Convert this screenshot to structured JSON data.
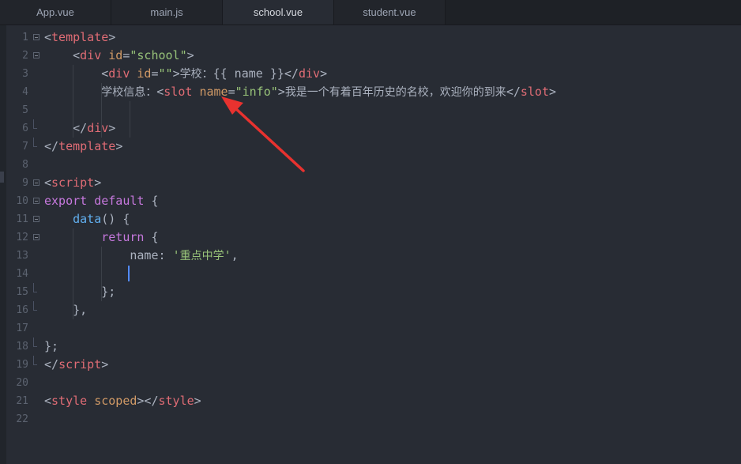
{
  "tabs": [
    {
      "label": "App.vue",
      "active": false
    },
    {
      "label": "main.js",
      "active": false
    },
    {
      "label": "school.vue",
      "active": true
    },
    {
      "label": "student.vue",
      "active": false
    }
  ],
  "gutter": [
    {
      "num": "1",
      "fold": "open"
    },
    {
      "num": "2",
      "fold": "open"
    },
    {
      "num": "3",
      "fold": ""
    },
    {
      "num": "4",
      "fold": ""
    },
    {
      "num": "5",
      "fold": ""
    },
    {
      "num": "6",
      "fold": "end"
    },
    {
      "num": "7",
      "fold": "end"
    },
    {
      "num": "8",
      "fold": ""
    },
    {
      "num": "9",
      "fold": "open"
    },
    {
      "num": "10",
      "fold": "open"
    },
    {
      "num": "11",
      "fold": "open"
    },
    {
      "num": "12",
      "fold": "open"
    },
    {
      "num": "13",
      "fold": ""
    },
    {
      "num": "14",
      "fold": ""
    },
    {
      "num": "15",
      "fold": "end"
    },
    {
      "num": "16",
      "fold": "end"
    },
    {
      "num": "17",
      "fold": ""
    },
    {
      "num": "18",
      "fold": "end"
    },
    {
      "num": "19",
      "fold": "end"
    },
    {
      "num": "20",
      "fold": ""
    },
    {
      "num": "21",
      "fold": ""
    },
    {
      "num": "22",
      "fold": ""
    }
  ],
  "code_lines": [
    [
      [
        "t-punct",
        "<"
      ],
      [
        "t-tag",
        "template"
      ],
      [
        "t-punct",
        ">"
      ]
    ],
    [
      [
        "t-text",
        "    "
      ],
      [
        "t-punct",
        "<"
      ],
      [
        "t-tag",
        "div"
      ],
      [
        "t-text",
        " "
      ],
      [
        "t-attr",
        "id"
      ],
      [
        "t-punct",
        "="
      ],
      [
        "t-str",
        "\"school\""
      ],
      [
        "t-punct",
        ">"
      ]
    ],
    [
      [
        "t-text",
        "        "
      ],
      [
        "t-punct",
        "<"
      ],
      [
        "t-tag",
        "div"
      ],
      [
        "t-text",
        " "
      ],
      [
        "t-attr",
        "id"
      ],
      [
        "t-punct",
        "="
      ],
      [
        "t-str",
        "\"\""
      ],
      [
        "t-punct",
        ">"
      ],
      [
        "t-text t-cjk",
        "学校："
      ],
      [
        "t-text",
        "{{ name }}"
      ],
      [
        "t-punct",
        "</"
      ],
      [
        "t-tag",
        "div"
      ],
      [
        "t-punct",
        ">"
      ]
    ],
    [
      [
        "t-text",
        "        "
      ],
      [
        "t-text t-cjk",
        "学校信息："
      ],
      [
        "t-punct",
        "<"
      ],
      [
        "t-tag",
        "slot"
      ],
      [
        "t-text",
        " "
      ],
      [
        "t-attr",
        "name"
      ],
      [
        "t-punct",
        "="
      ],
      [
        "t-str",
        "\"info\""
      ],
      [
        "t-punct",
        ">"
      ],
      [
        "t-text t-cjk",
        "我是一个有着百年历史的名校，欢迎你的到来"
      ],
      [
        "t-punct",
        "</"
      ],
      [
        "t-tag",
        "slot"
      ],
      [
        "t-punct",
        ">"
      ]
    ],
    [],
    [
      [
        "t-text",
        "    "
      ],
      [
        "t-punct",
        "</"
      ],
      [
        "t-tag",
        "div"
      ],
      [
        "t-punct",
        ">"
      ]
    ],
    [
      [
        "t-punct",
        "</"
      ],
      [
        "t-tag",
        "template"
      ],
      [
        "t-punct",
        ">"
      ]
    ],
    [],
    [
      [
        "t-punct",
        "<"
      ],
      [
        "t-tag",
        "script"
      ],
      [
        "t-punct",
        ">"
      ]
    ],
    [
      [
        "t-kw",
        "export"
      ],
      [
        "t-text",
        " "
      ],
      [
        "t-kw",
        "default"
      ],
      [
        "t-text",
        " {"
      ]
    ],
    [
      [
        "t-text",
        "    "
      ],
      [
        "t-fn",
        "data"
      ],
      [
        "t-text",
        "() {"
      ]
    ],
    [
      [
        "t-text",
        "        "
      ],
      [
        "t-kw",
        "return"
      ],
      [
        "t-text",
        " {"
      ]
    ],
    [
      [
        "t-text",
        "            name: "
      ],
      [
        "t-str",
        "'"
      ],
      [
        "t-str t-cjk",
        "重点中学"
      ],
      [
        "t-str",
        "'"
      ],
      [
        "t-text",
        ","
      ]
    ],
    [],
    [
      [
        "t-text",
        "        };"
      ]
    ],
    [
      [
        "t-text",
        "    },"
      ]
    ],
    [],
    [
      [
        "t-text",
        "};"
      ]
    ],
    [
      [
        "t-punct",
        "</"
      ],
      [
        "t-tag",
        "script"
      ],
      [
        "t-punct",
        ">"
      ]
    ],
    [],
    [
      [
        "t-punct",
        "<"
      ],
      [
        "t-tag",
        "style"
      ],
      [
        "t-text",
        " "
      ],
      [
        "t-attr",
        "scoped"
      ],
      [
        "t-punct",
        "></"
      ],
      [
        "t-tag",
        "style"
      ],
      [
        "t-punct",
        ">"
      ]
    ],
    []
  ],
  "colors": {
    "annotation_arrow": "#e8322f",
    "cursor": "#528bff"
  }
}
